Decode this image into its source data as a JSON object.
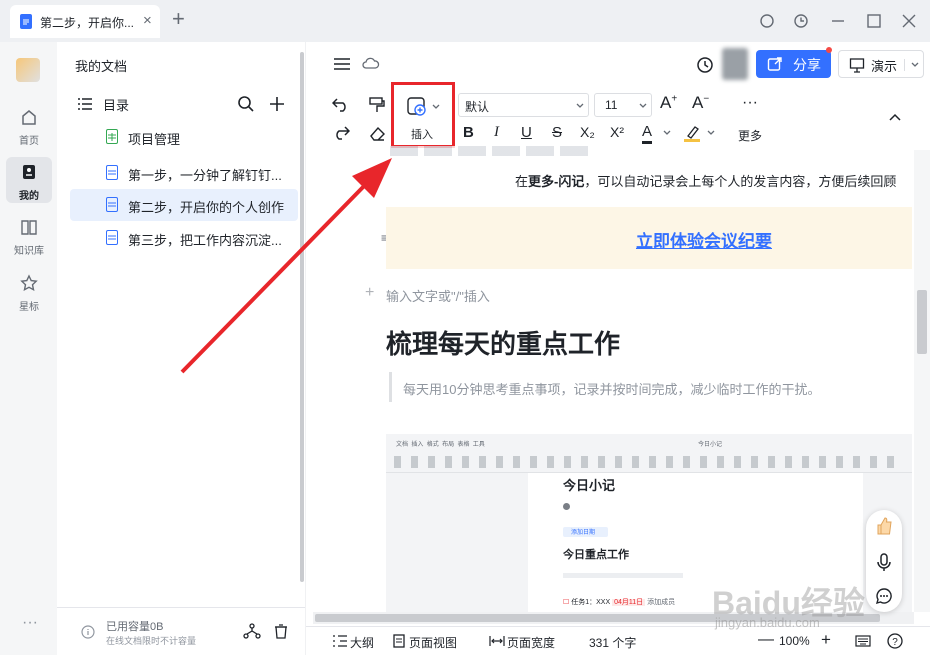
{
  "window": {
    "tab_title": "第二步，开启你..."
  },
  "rail": {
    "items": [
      {
        "label": "首页"
      },
      {
        "label": "我的"
      },
      {
        "label": "知识库"
      },
      {
        "label": "星标"
      }
    ]
  },
  "tree": {
    "header": "我的文档",
    "toc_label": "目录",
    "items": [
      "项目管理",
      "第一步，一分钟了解钉钉...",
      "第二步，开启你的个人创作",
      "第三步，把工作内容沉淀..."
    ],
    "storage": "已用容量0B",
    "storage_note": "在线文档限时不计容量"
  },
  "header": {
    "share_label": "分享",
    "present_label": "演示"
  },
  "toolbar": {
    "insert_label": "插入",
    "font_family": "默认",
    "font_size": "11",
    "more_label": "更多",
    "bold": "B",
    "italic": "I",
    "underline": "U",
    "strike": "S",
    "sub": "X₂",
    "sup": "X²",
    "color": "A"
  },
  "doc": {
    "line1_a": "在",
    "line1_b": "更多-闪记",
    "line1_c": "，可以自动记录会上每个人的发言内容，方便后续回顾",
    "callout_link": "立即体验会议纪要",
    "placeholder": "输入文字或\"/\"插入",
    "heading": "梳理每天的重点工作",
    "quote": "每天用10分钟思考重点事项，记录并按时间完成，减少临时工作的干扰。"
  },
  "embedded": {
    "menu": [
      "文档",
      "插入",
      "格式",
      "布局",
      "表格",
      "工具"
    ],
    "center": "今日小记",
    "title": "今日小记",
    "subtitle": "今日重点工作",
    "tag": "添加日期",
    "task": "任务1：XXX",
    "date": "04月11日",
    "member": "添加成员"
  },
  "bottom": {
    "outline": "大纲",
    "page_view": "页面视图",
    "page_width": "页面宽度",
    "word_count": "331 个字",
    "zoom": "100%"
  },
  "watermark": {
    "text": "Baidu经验",
    "url": "jingyan.baidu.com"
  },
  "colors": {
    "accent": "#3370ff",
    "annotation": "#e8262b",
    "callout_bg": "#fdf6e6"
  }
}
